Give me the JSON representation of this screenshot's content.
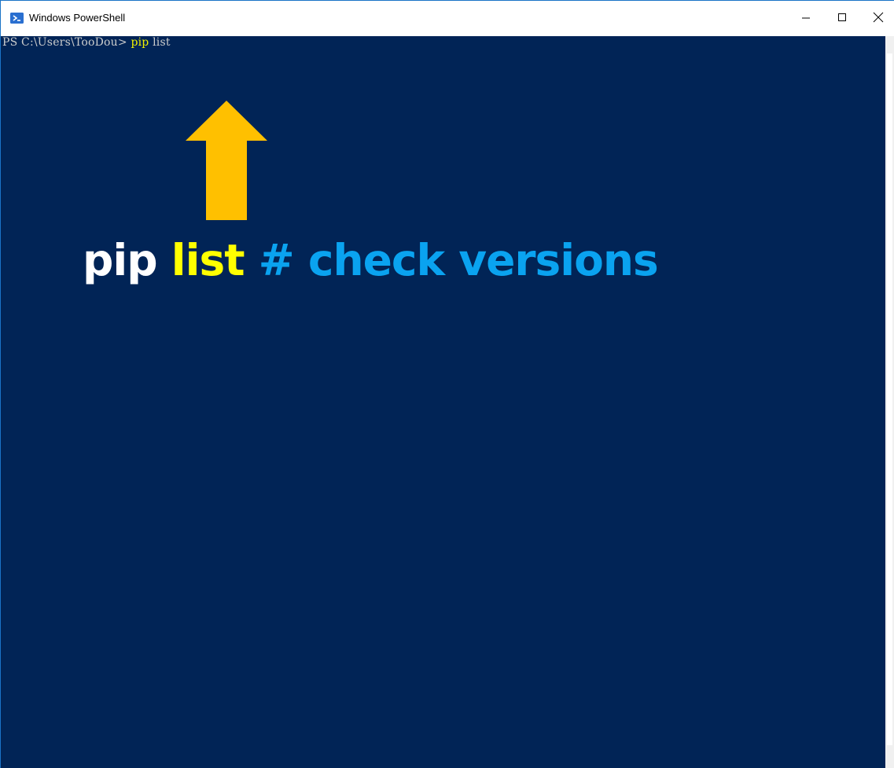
{
  "window": {
    "title": "Windows PowerShell",
    "app_icon": "powershell-icon",
    "controls": {
      "minimize_icon": "minimize-icon",
      "maximize_icon": "maximize-icon",
      "close_icon": "close-icon"
    }
  },
  "console": {
    "prompt": "PS C:\\Users\\TooDou> ",
    "command": "pip",
    "argument": " list",
    "background": "#012456",
    "command_color": "#f2f200"
  },
  "annotation": {
    "arrow_icon": "up-arrow-icon",
    "arrow_color": "#ffc000",
    "part1": "pip ",
    "part2": "list",
    "part3": " # check versions",
    "colors": {
      "part1": "#ffffff",
      "part2": "#ffff00",
      "part3": "#0aa3f0"
    }
  }
}
